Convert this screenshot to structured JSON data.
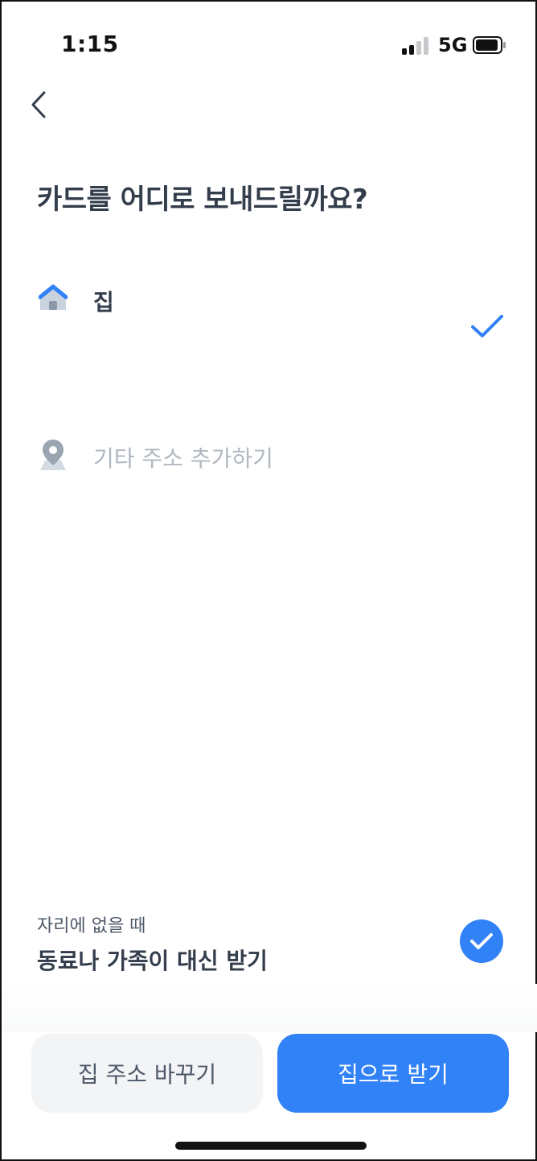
{
  "status_bar": {
    "time": "1:15",
    "network": "5G"
  },
  "header": {
    "back_icon": "chevron-left-icon"
  },
  "title": "카드를 어디로 보내드릴까요?",
  "options": {
    "home": {
      "label": "집",
      "icon": "home-icon",
      "selected": true
    },
    "other": {
      "label": "기타 주소 추가하기",
      "icon": "map-pin-icon"
    }
  },
  "proxy": {
    "subtitle": "자리에 없을 때",
    "title": "동료나 가족이 대신 받기",
    "checked": true
  },
  "buttons": {
    "change_address": "집 주소 바꾸기",
    "receive_home": "집으로 받기"
  },
  "colors": {
    "accent": "#3182f6",
    "text_primary": "#333d4b",
    "text_muted": "#b0b8c1",
    "button_secondary_bg": "#f2f4f6"
  }
}
